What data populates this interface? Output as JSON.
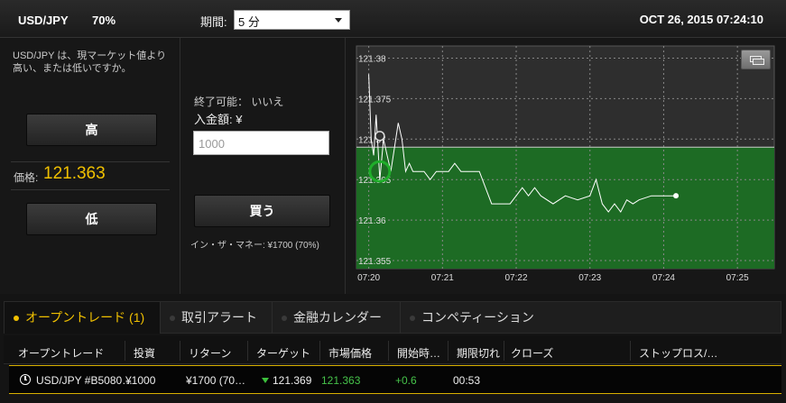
{
  "header": {
    "pair": "USD/JPY",
    "payout": "70%",
    "period_label": "期間:",
    "period_value": "5 分",
    "datetime": "OCT 26, 2015 07:24:10"
  },
  "trade_panel": {
    "question": "USD/JPY は、現マーケット値より高い、または低いですか。",
    "high_label": "高",
    "low_label": "低",
    "price_label": "価格:",
    "price_value": "121.363"
  },
  "order_panel": {
    "expire_text": "終了可能： いいえ",
    "amount_label": "入金額: ¥",
    "amount_placeholder": "1000",
    "buy_label": "買う",
    "return_note": "イン・ザ・マネー: ¥1700 (70%)"
  },
  "chart_data": {
    "type": "line",
    "yticks": [
      "121.38",
      "121.375",
      "121.37",
      "121.365",
      "121.36",
      "121.355"
    ],
    "xticks": [
      "07:20",
      "07:21",
      "07:22",
      "07:23",
      "07:24",
      "07:25"
    ],
    "ylim": [
      121.355,
      121.38
    ],
    "target_price": 121.369,
    "series": [
      {
        "x": [
          "07:20:00",
          "07:20:02",
          "07:20:04",
          "07:20:06",
          "07:20:09",
          "07:20:12",
          "07:20:15",
          "07:20:18",
          "07:20:21",
          "07:20:24",
          "07:20:27",
          "07:20:30",
          "07:20:33",
          "07:20:36",
          "07:20:39",
          "07:20:42",
          "07:20:45",
          "07:20:50",
          "07:20:55",
          "07:21:00",
          "07:21:05",
          "07:21:10",
          "07:21:15",
          "07:21:20",
          "07:21:25",
          "07:21:30",
          "07:21:40",
          "07:21:50",
          "07:21:55",
          "07:22:00",
          "07:22:05",
          "07:22:10",
          "07:22:15",
          "07:22:20",
          "07:22:30",
          "07:22:40",
          "07:22:50",
          "07:23:00",
          "07:23:05",
          "07:23:10",
          "07:23:15",
          "07:23:20",
          "07:23:25",
          "07:23:30",
          "07:23:35",
          "07:23:40",
          "07:23:50",
          "07:24:00",
          "07:24:10"
        ],
        "y": [
          121.378,
          121.37,
          121.368,
          121.373,
          121.365,
          121.37,
          121.368,
          121.366,
          121.369,
          121.372,
          121.37,
          121.366,
          121.367,
          121.366,
          121.366,
          121.366,
          121.366,
          121.365,
          121.366,
          121.366,
          121.366,
          121.367,
          121.366,
          121.366,
          121.366,
          121.366,
          121.362,
          121.362,
          121.362,
          121.363,
          121.364,
          121.363,
          121.364,
          121.363,
          121.362,
          121.363,
          121.3625,
          121.363,
          121.365,
          121.362,
          121.361,
          121.362,
          121.361,
          121.3625,
          121.362,
          121.3625,
          121.363,
          121.363,
          121.363
        ],
        "color": "#ffffff"
      }
    ],
    "up_zone_color": "#1d6b24",
    "grid": true
  },
  "tabs": [
    {
      "label": "オープントレード (1)",
      "active": true
    },
    {
      "label": "取引アラート",
      "active": false
    },
    {
      "label": "金融カレンダー",
      "active": false
    },
    {
      "label": "コンペティーション",
      "active": false
    }
  ],
  "table": {
    "headers": [
      "オープントレード",
      "投資",
      "リターン",
      "ターゲット",
      "市場価格",
      "開始時…",
      "期限切れ",
      "クローズ",
      "ストップロス/…"
    ],
    "row": {
      "asset": "USD/JPY #B5080…",
      "invest": "¥1000",
      "return": "¥1700 (70…",
      "target": "121.369",
      "market": "121.363",
      "open": "+0.6",
      "expiry": "00:53"
    }
  },
  "colors": {
    "accent": "#f0c000",
    "up_green": "#1d6b24",
    "positive": "#46c24a"
  }
}
